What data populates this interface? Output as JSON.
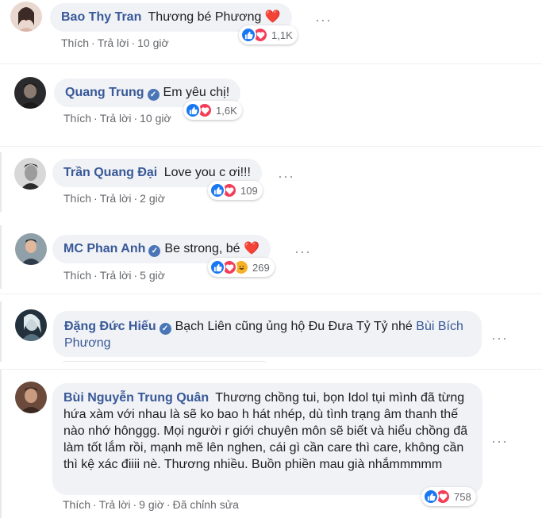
{
  "comments": [
    {
      "author": "Bao Thy Tran",
      "text": "Thương bé Phương",
      "heart": "❤️",
      "verified": false,
      "reaction_count": "1,1K",
      "reactions": [
        "like",
        "love"
      ],
      "actions": {
        "like": "Thích",
        "reply": "Trả lời",
        "time": "10 giờ"
      }
    },
    {
      "author": "Quang Trung",
      "text": "Em yêu chị!",
      "verified": true,
      "reaction_count": "1,6K",
      "reactions": [
        "like",
        "love"
      ],
      "actions": {
        "like": "Thích",
        "reply": "Trả lời",
        "time": "10 giờ"
      }
    },
    {
      "author": "Trần Quang Đại",
      "text": "Love you c ơi!!!",
      "verified": false,
      "reaction_count": "109",
      "reactions": [
        "like",
        "love"
      ],
      "actions": {
        "like": "Thích",
        "reply": "Trả lời",
        "time": "2 giờ"
      }
    },
    {
      "author": "MC Phan Anh",
      "text": "Be strong, bé",
      "heart": "❤️",
      "verified": true,
      "reaction_count": "269",
      "reactions": [
        "like",
        "love",
        "haha"
      ],
      "actions": {
        "like": "Thích",
        "reply": "Trả lời",
        "time": "5 giờ"
      }
    },
    {
      "author": "Đặng Đức Hiếu",
      "text": "Bạch Liên cũng ủng hộ Đu Đưa Tỷ Tỷ nhé",
      "tag": "Bùi Bích Phương",
      "verified": true
    },
    {
      "author": "Bùi Nguyễn Trung Quân",
      "text": "Thương chồng tui, bọn Idol tụi mình đã từng hứa xàm với nhau là sẽ ko bao h hát nhép, dù tình trạng âm thanh thế nào nhớ hônggg. Mọi người r giới chuyên môn sẽ biết và hiểu chồng đã làm tốt lắm rồi, mạnh mẽ lên nghen, cái gì cần care thì care, không cần thì kệ xác điiii nè. Thương nhiều. Buồn phiền mau già nhắmmmmm",
      "verified": false,
      "reaction_count": "758",
      "reactions": [
        "like",
        "love"
      ],
      "actions": {
        "like": "Thích",
        "reply": "Trả lời",
        "time": "9 giờ",
        "edited": "Đã chỉnh sửa"
      }
    }
  ],
  "colors": {
    "name": "#385898",
    "bubble": "#f0f2f5",
    "like": "#1877f2",
    "love": "#f33e58",
    "meta": "#65676b"
  }
}
